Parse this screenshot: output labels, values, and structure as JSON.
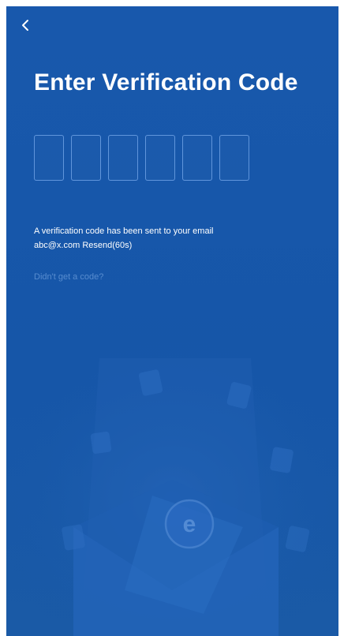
{
  "nav": {
    "back_icon": "chevron-left-icon"
  },
  "title": "Enter Verification Code",
  "code": {
    "digits": [
      "",
      "",
      "",
      "",
      "",
      ""
    ]
  },
  "info": {
    "line1": "A verification code has been sent to your email",
    "email": "abc@x.com",
    "resend": "Resend(60s)"
  },
  "help_link": "Didn't get a code?",
  "illustration": {
    "badge_letter": "e"
  },
  "colors": {
    "background": "#1656a8",
    "box_border": "#78aaeb",
    "text": "#ffffff",
    "muted_link": "#82afe8"
  }
}
